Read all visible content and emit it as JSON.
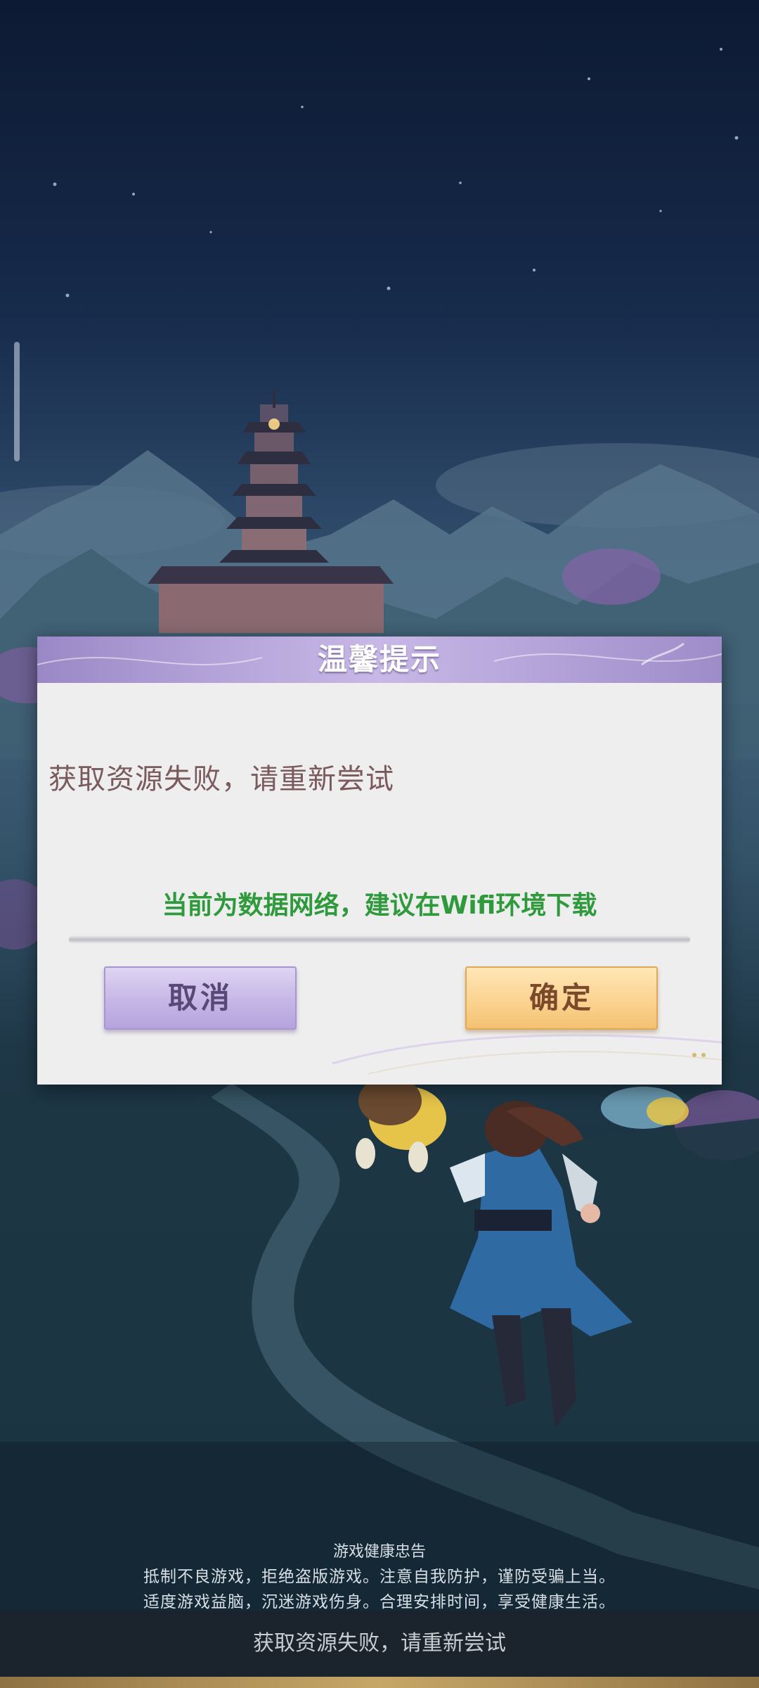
{
  "dialog": {
    "title": "温馨提示",
    "message": "获取资源失败，请重新尝试",
    "hint": "当前为数据网络，建议在Wifi环境下载",
    "cancel_label": "取消",
    "confirm_label": "确定"
  },
  "notice": {
    "title": "游戏健康忠告",
    "line1": "抵制不良游戏，拒绝盗版游戏。注意自我防护，谨防受骗上当。",
    "line2": "适度游戏益脑，沉迷游戏伤身。合理安排时间，享受健康生活。"
  },
  "status": {
    "text": "获取资源失败，请重新尝试"
  },
  "colors": {
    "dialog_header": "#b3a2d8",
    "hint_green": "#2f9a3c",
    "message_brown": "#7a5a5c",
    "cancel_button": "#c6b6e6",
    "confirm_button": "#fbd391"
  }
}
